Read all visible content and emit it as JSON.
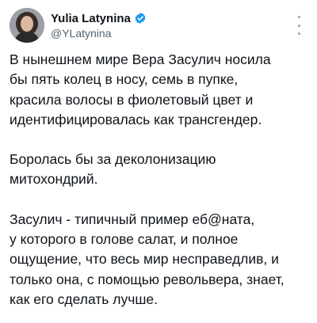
{
  "author": {
    "display_name": "Yulia Latynina",
    "handle": "@YLatynina",
    "verified_icon": "verified-badge-icon",
    "verified_color": "#1d9bf0"
  },
  "more_icon": "more-options-icon",
  "tweet": {
    "paragraphs": [
      {
        "lines": [
          "В нынешнем мире Вера Засулич носила",
          "бы пять колец в носу, семь в пупке,",
          "красила волосы в фиолетовый цвет и",
          "идентифицировалась как трансгендер."
        ]
      },
      {
        "lines": [
          "Боролась бы за деколонизацию",
          "митохондрий."
        ]
      },
      {
        "lines": [
          "Засулич - типичный пример еб@ната,",
          "у которого в голове салат, и полное",
          "ощущение, что весь мир несправедлив, и",
          "только она, с помощью револьвера, знает,",
          "как его сделать лучше."
        ]
      }
    ]
  }
}
